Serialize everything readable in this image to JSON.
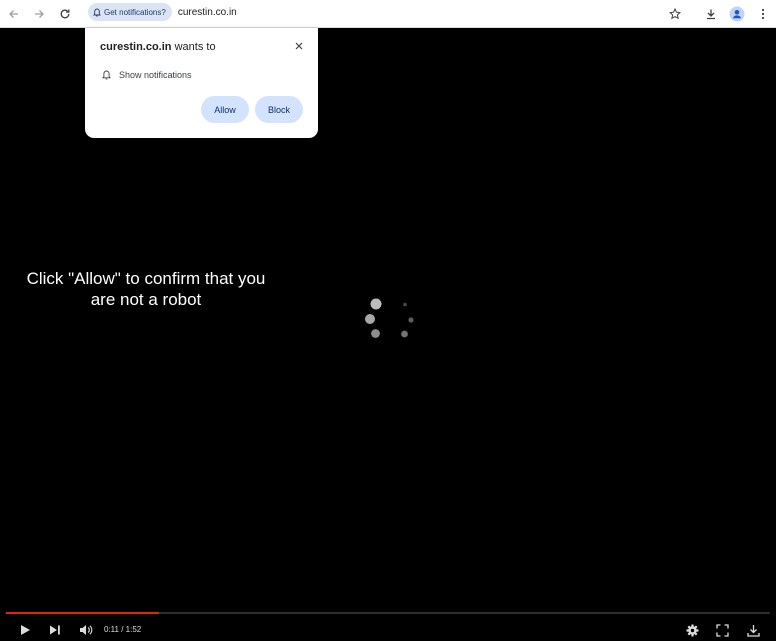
{
  "browser": {
    "chip_label": "Get notifications?",
    "url": "curestin.co.in"
  },
  "popup": {
    "site": "curestin.co.in",
    "wants_to": "wants to",
    "permission_label": "Show notifications",
    "allow_label": "Allow",
    "block_label": "Block"
  },
  "page": {
    "message": "Click \"Allow\" to confirm that you are not a robot"
  },
  "player": {
    "current_time": "0:11",
    "duration": "1:52",
    "time_display": "0:11 / 1:52",
    "progress": 0.2,
    "progress_color": "#e62117"
  },
  "icons": [
    "back-icon",
    "forward-icon",
    "reload-icon",
    "bell-icon",
    "star-icon",
    "download-icon",
    "profile-icon",
    "menu-icon",
    "close-icon",
    "play-icon",
    "next-icon",
    "volume-icon",
    "settings-icon",
    "fullscreen-icon",
    "video-download-icon"
  ]
}
